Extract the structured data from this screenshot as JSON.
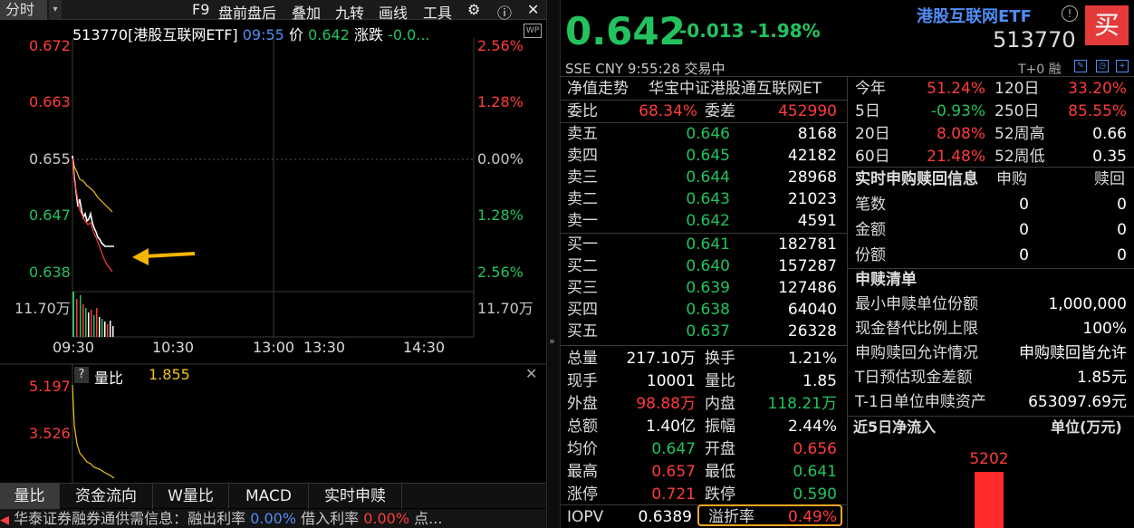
{
  "toolbar": {
    "mode": "分时",
    "items": [
      "F9",
      "盘前盘后",
      "叠加",
      "九转",
      "画线",
      "工具"
    ]
  },
  "chart": {
    "header": {
      "name": "513770[港股互联网ETF]",
      "time": "09:55",
      "price_label": "价",
      "price": "0.642",
      "change_label": "涨跌",
      "change": "-0.0..."
    },
    "y_left": [
      "0.672",
      "0.663",
      "0.655",
      "0.647",
      "0.638"
    ],
    "y_right": [
      "2.56%",
      "1.28%",
      "0.00%",
      "1.28%",
      "2.56%"
    ],
    "volume_label": "11.70万",
    "x_labels": [
      "09:30",
      "10:30",
      "13:00",
      "13:30",
      "14:30"
    ],
    "sub_panel": {
      "title": "量比",
      "value": "1.855",
      "y": [
        "5.197",
        "3.526"
      ]
    }
  },
  "bottom_tabs": [
    "量比",
    "资金流向",
    "W量比",
    "MACD",
    "实时申赎"
  ],
  "ticker": {
    "text1": "华泰证券融券通供需信息：融出利率",
    "rate1": "0.00%",
    "text2": "借入利率",
    "rate2": "0.00%",
    "tail": "点..."
  },
  "quote": {
    "price": "0.642",
    "change": "-0.013",
    "change_pct": "-1.98%",
    "name": "港股互联网ETF",
    "code": "513770",
    "buy_button": "买",
    "sub_info": "SSE  CNY  9:55:28  交易中",
    "t0": "T+0  融"
  },
  "left_table": {
    "title": "净值走势",
    "fund_name": "华宝中证港股通互联网ET",
    "weibi_label": "委比",
    "weibi": "68.34%",
    "weicha_label": "委差",
    "weicha": "452990",
    "asks": [
      {
        "label": "卖五",
        "price": "0.646",
        "vol": "8168"
      },
      {
        "label": "卖四",
        "price": "0.645",
        "vol": "42182"
      },
      {
        "label": "卖三",
        "price": "0.644",
        "vol": "28968"
      },
      {
        "label": "卖二",
        "price": "0.643",
        "vol": "21023"
      },
      {
        "label": "卖一",
        "price": "0.642",
        "vol": "4591"
      }
    ],
    "bids": [
      {
        "label": "买一",
        "price": "0.641",
        "vol": "182781"
      },
      {
        "label": "买二",
        "price": "0.640",
        "vol": "157287"
      },
      {
        "label": "买三",
        "price": "0.639",
        "vol": "127486"
      },
      {
        "label": "买四",
        "price": "0.638",
        "vol": "64040"
      },
      {
        "label": "买五",
        "price": "0.637",
        "vol": "26328"
      }
    ],
    "stats": [
      {
        "l1": "总量",
        "v1": "217.10万",
        "c1": "white",
        "l2": "换手",
        "v2": "1.21%",
        "c2": "white"
      },
      {
        "l1": "现手",
        "v1": "10001",
        "c1": "white",
        "l2": "量比",
        "v2": "1.85",
        "c2": "white"
      },
      {
        "l1": "外盘",
        "v1": "98.88万",
        "c1": "red",
        "l2": "内盘",
        "v2": "118.21万",
        "c2": "green"
      },
      {
        "l1": "总额",
        "v1": "1.40亿",
        "c1": "white",
        "l2": "振幅",
        "v2": "2.44%",
        "c2": "white"
      },
      {
        "l1": "均价",
        "v1": "0.647",
        "c1": "green",
        "l2": "开盘",
        "v2": "0.656",
        "c2": "red"
      },
      {
        "l1": "最高",
        "v1": "0.657",
        "c1": "red",
        "l2": "最低",
        "v2": "0.641",
        "c2": "green"
      },
      {
        "l1": "涨停",
        "v1": "0.721",
        "c1": "red",
        "l2": "跌停",
        "v2": "0.590",
        "c2": "green"
      }
    ],
    "iopv_label": "IOPV",
    "iopv": "0.6389",
    "premium_label": "溢折率",
    "premium": "0.49%"
  },
  "right_table": {
    "perf": [
      {
        "l1": "今年",
        "v1": "51.24%",
        "c1": "red",
        "l2": "120日",
        "v2": "33.20%",
        "c2": "red"
      },
      {
        "l1": "5日",
        "v1": "-0.93%",
        "c1": "green",
        "l2": "250日",
        "v2": "85.55%",
        "c2": "red"
      },
      {
        "l1": "20日",
        "v1": "8.08%",
        "c1": "red",
        "l2": "52周高",
        "v2": "0.66",
        "c2": "white"
      },
      {
        "l1": "60日",
        "v1": "21.48%",
        "c1": "red",
        "l2": "52周低",
        "v2": "0.35",
        "c2": "white"
      }
    ],
    "realtime": {
      "title": "实时申购赎回信息",
      "col1": "申购",
      "col2": "赎回",
      "rows": [
        {
          "label": "笔数",
          "v1": "0",
          "v2": "0"
        },
        {
          "label": "金额",
          "v1": "0",
          "v2": "0"
        },
        {
          "label": "份额",
          "v1": "0",
          "v2": "0"
        }
      ]
    },
    "list": {
      "title": "申赎清单",
      "rows": [
        {
          "label": "最小申赎单位份额",
          "value": "1,000,000"
        },
        {
          "label": "现金替代比例上限",
          "value": "100%"
        },
        {
          "label": "申购赎回允许情况",
          "value": "申购赎回皆允许"
        },
        {
          "label": "T日预估现金差额",
          "value": "1.85元"
        },
        {
          "label": "T-1日单位申赎资产",
          "value": "653097.69元"
        }
      ]
    },
    "inflow": {
      "title": "近5日净流入",
      "unit": "单位(万元)",
      "values": [
        5202
      ]
    }
  },
  "colors": {
    "up": "#ff3b3b",
    "down": "#22c35e",
    "accent": "#4f8df6",
    "highlight": "#f5a623"
  }
}
